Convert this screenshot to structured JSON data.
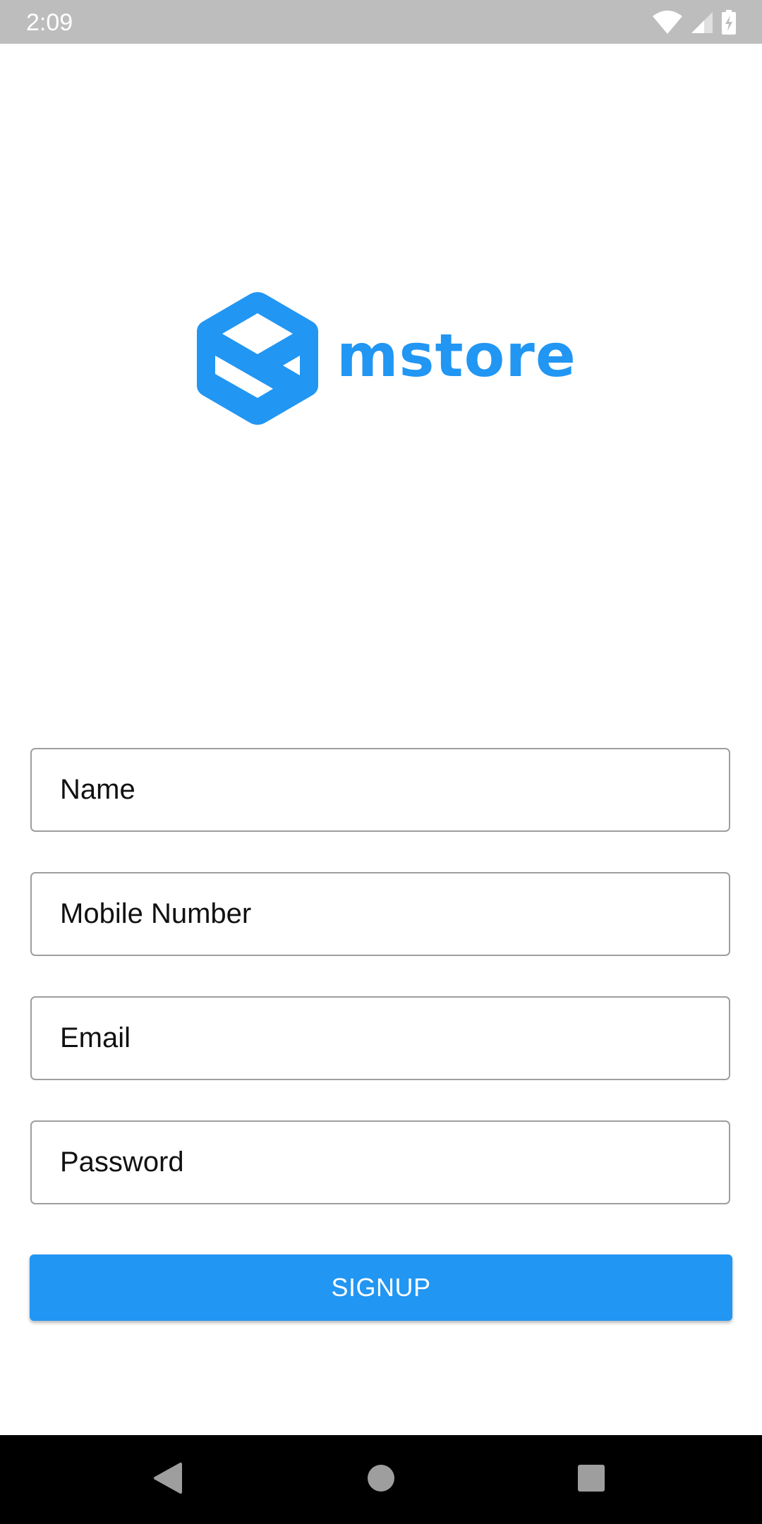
{
  "status_bar": {
    "time": "2:09",
    "icons": [
      "wifi-icon",
      "cell-signal-icon",
      "battery-charging-icon"
    ]
  },
  "logo": {
    "text": "mstore",
    "color": "#2196f3",
    "icon": "mstore-hexagon-logo-icon"
  },
  "form": {
    "name_placeholder": "Name",
    "mobile_placeholder": "Mobile Number",
    "email_placeholder": "Email",
    "password_placeholder": "Password",
    "signup_label": "SIGNUP",
    "accent_color": "#2196f3"
  },
  "nav_bar": {
    "buttons": [
      "back-icon",
      "home-icon",
      "recents-icon"
    ]
  }
}
